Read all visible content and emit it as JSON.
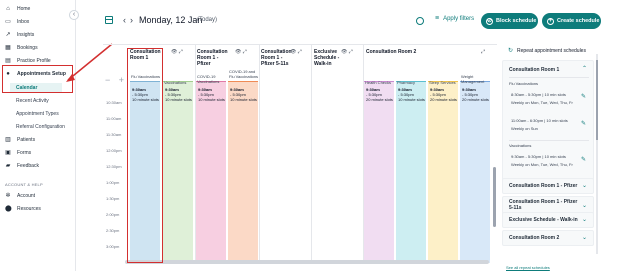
{
  "sidebar": {
    "items": [
      {
        "name": "home",
        "icon": "home-icon",
        "glyph": "⌂",
        "label": "Home"
      },
      {
        "name": "inbox",
        "icon": "inbox-icon",
        "glyph": "▭",
        "label": "Inbox"
      },
      {
        "name": "insights",
        "icon": "insights-icon",
        "glyph": "↗",
        "label": "Insights"
      },
      {
        "name": "bookings",
        "icon": "bookings-icon",
        "glyph": "▦",
        "label": "Bookings"
      },
      {
        "name": "practice-profile",
        "icon": "building-icon",
        "glyph": "▤",
        "label": "Practice Profile"
      },
      {
        "name": "appointments-setup",
        "icon": "gear-icon",
        "glyph": "●",
        "label": "Appointments Setup"
      }
    ],
    "sub_items": [
      "Calendar",
      "Recent Activity",
      "Appointment Types",
      "Referral Configuration"
    ],
    "items2": [
      {
        "name": "patients",
        "icon": "patients-icon",
        "glyph": "▥",
        "label": "Patients"
      },
      {
        "name": "forms",
        "icon": "forms-icon",
        "glyph": "▣",
        "label": "Forms"
      },
      {
        "name": "feedback",
        "icon": "feedback-icon",
        "glyph": "▰",
        "label": "Feedback"
      }
    ],
    "section_label": "ACCOUNT & HELP",
    "items3": [
      {
        "name": "account",
        "icon": "gear-icon",
        "glyph": "✲",
        "label": "Account"
      },
      {
        "name": "resources",
        "icon": "pin-icon",
        "glyph": "⬤",
        "label": "Resources"
      }
    ],
    "collapse": "‹"
  },
  "header": {
    "date": "Monday, 12 Jan",
    "today": "(Today)",
    "prev": "‹",
    "next": "›",
    "filters": "Apply filters",
    "block": "Block schedule",
    "create": "Create schedule"
  },
  "calendar": {
    "zoom_out": "−",
    "zoom_in": "+",
    "times": [
      "10:30am",
      "11:00am",
      "11:30am",
      "12:00pm",
      "12:30pm",
      "1:00pm",
      "1:30pm",
      "2:00pm",
      "2:30pm",
      "3:00pm"
    ],
    "columns": [
      {
        "title": "Consultation Room 1",
        "icons": "👁 ⤢"
      },
      {
        "title": "Consultation Room 1 - Pfizer",
        "icons": "👁 ⤢"
      },
      {
        "title": "Consultation Room 1 - Pfizer 5-11s",
        "icons": "👁 ⤢"
      },
      {
        "title": "Exclusive Schedule - Walk-in",
        "icons": "👁 ⤢"
      },
      {
        "title": "Consultation Room 2",
        "icons": "⤢"
      }
    ],
    "lanes": [
      {
        "label": "Flu Vaccinations",
        "time": "9:30am",
        "end": "- 5:30pm",
        "slots": "10 minute slots",
        "color": "#cfe4f2",
        "border": "#7fb3d5"
      },
      {
        "label": "Vaccinations",
        "time": "9:30am",
        "end": "- 5:30pm",
        "slots": "10 minute slots",
        "color": "#dff0d8",
        "border": "#a3cf8f"
      },
      {
        "label": "COVID-19 Vaccinations",
        "time": "9:30am",
        "end": "- 5:30pm",
        "slots": "10 minute slots",
        "color": "#f7cfe1",
        "border": "#e27aa8"
      },
      {
        "label": "COVID-19 and Flu Vaccinations",
        "time": "9:30am",
        "end": "- 5:30pm",
        "slots": "10 minute slots",
        "color": "#fbd9c6",
        "border": "#ef8b56"
      },
      {
        "label": "Health Checks",
        "time": "9:30am",
        "end": "- 5:30pm",
        "slots": "20 minute slots",
        "color": "#f1ddf2",
        "border": "#c98bd1"
      },
      {
        "label": "Pharmacy",
        "time": "9:30am",
        "end": "- 5:30pm",
        "slots": "10 minute slots",
        "color": "#cdeef2",
        "border": "#5bbfcf"
      },
      {
        "label": "Sleep Services",
        "time": "9:30am",
        "end": "- 5:30pm",
        "slots": "20 minute slots",
        "color": "#fdf0c8",
        "border": "#f0c44a"
      },
      {
        "label": "Weight Management",
        "time": "9:30am",
        "end": "- 5:30pm",
        "slots": "20 minute slots",
        "color": "#d8e8f8",
        "border": "#79a8e0"
      }
    ]
  },
  "panel": {
    "title": "Repeat appointment schedules",
    "sections": [
      {
        "title": "Consultation Room 1",
        "chev": "⌃"
      },
      {
        "title": "Consultation Room 1 - Pfizer",
        "chev": "⌄"
      },
      {
        "title": "Consultation Room 1 - Pfizer 5-11s",
        "chev": "⌄"
      },
      {
        "title": "Exclusive Schedule - Walk-in",
        "chev": "⌄"
      },
      {
        "title": "Consultation Room 2",
        "chev": "⌄"
      }
    ],
    "group1": "Flu Vaccinations",
    "entry1_a": "8:30am - 5:30pm  |  10 min slots",
    "entry1_b": "Weekly on Mon, Tue, Wed, Thu, Fr",
    "entry2_a": "11:00am - 6:30pm  |  10 min slots",
    "entry2_b": "Weekly on Sun",
    "group2": "Vaccinations",
    "entry3_a": "9:30am - 5:30pm  |  10 min slots",
    "entry3_b": "Weekly on Mon, Tue, Wed, Thu, Fr",
    "edit": "✎",
    "footer": "See all repeat schedules"
  }
}
